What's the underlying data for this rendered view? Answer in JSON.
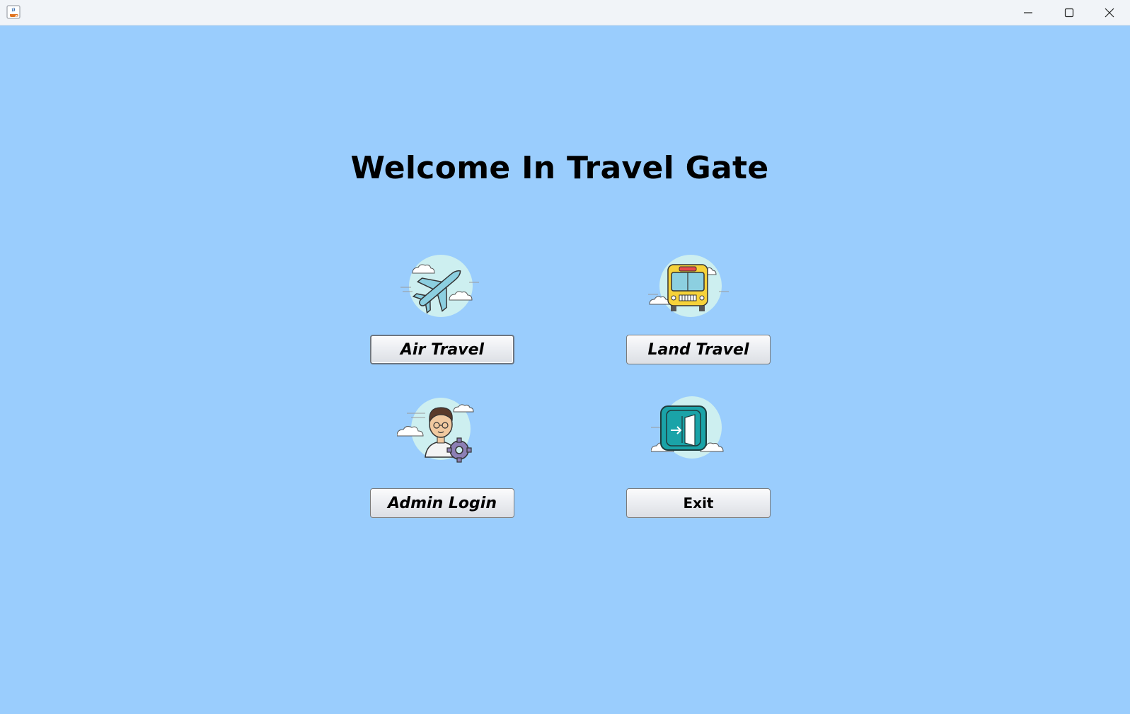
{
  "window": {
    "title": "",
    "icons": {
      "app": "java-cup-icon",
      "minimize": "minimize-icon",
      "maximize": "maximize-icon",
      "close": "close-icon"
    }
  },
  "main": {
    "title": "Welcome In Travel Gate",
    "buttons": {
      "air": "Air Travel",
      "land": "Land Travel",
      "admin": "Admin Login",
      "exit": "Exit"
    },
    "illustrations": {
      "air": "airplane-icon",
      "land": "bus-icon",
      "admin": "admin-person-icon",
      "exit": "exit-door-icon"
    }
  },
  "colors": {
    "background": "#9acdfd",
    "titlebar": "#f1f4f8",
    "cloud_blob": "#cdeff0",
    "teal": "#1aa3a8"
  }
}
